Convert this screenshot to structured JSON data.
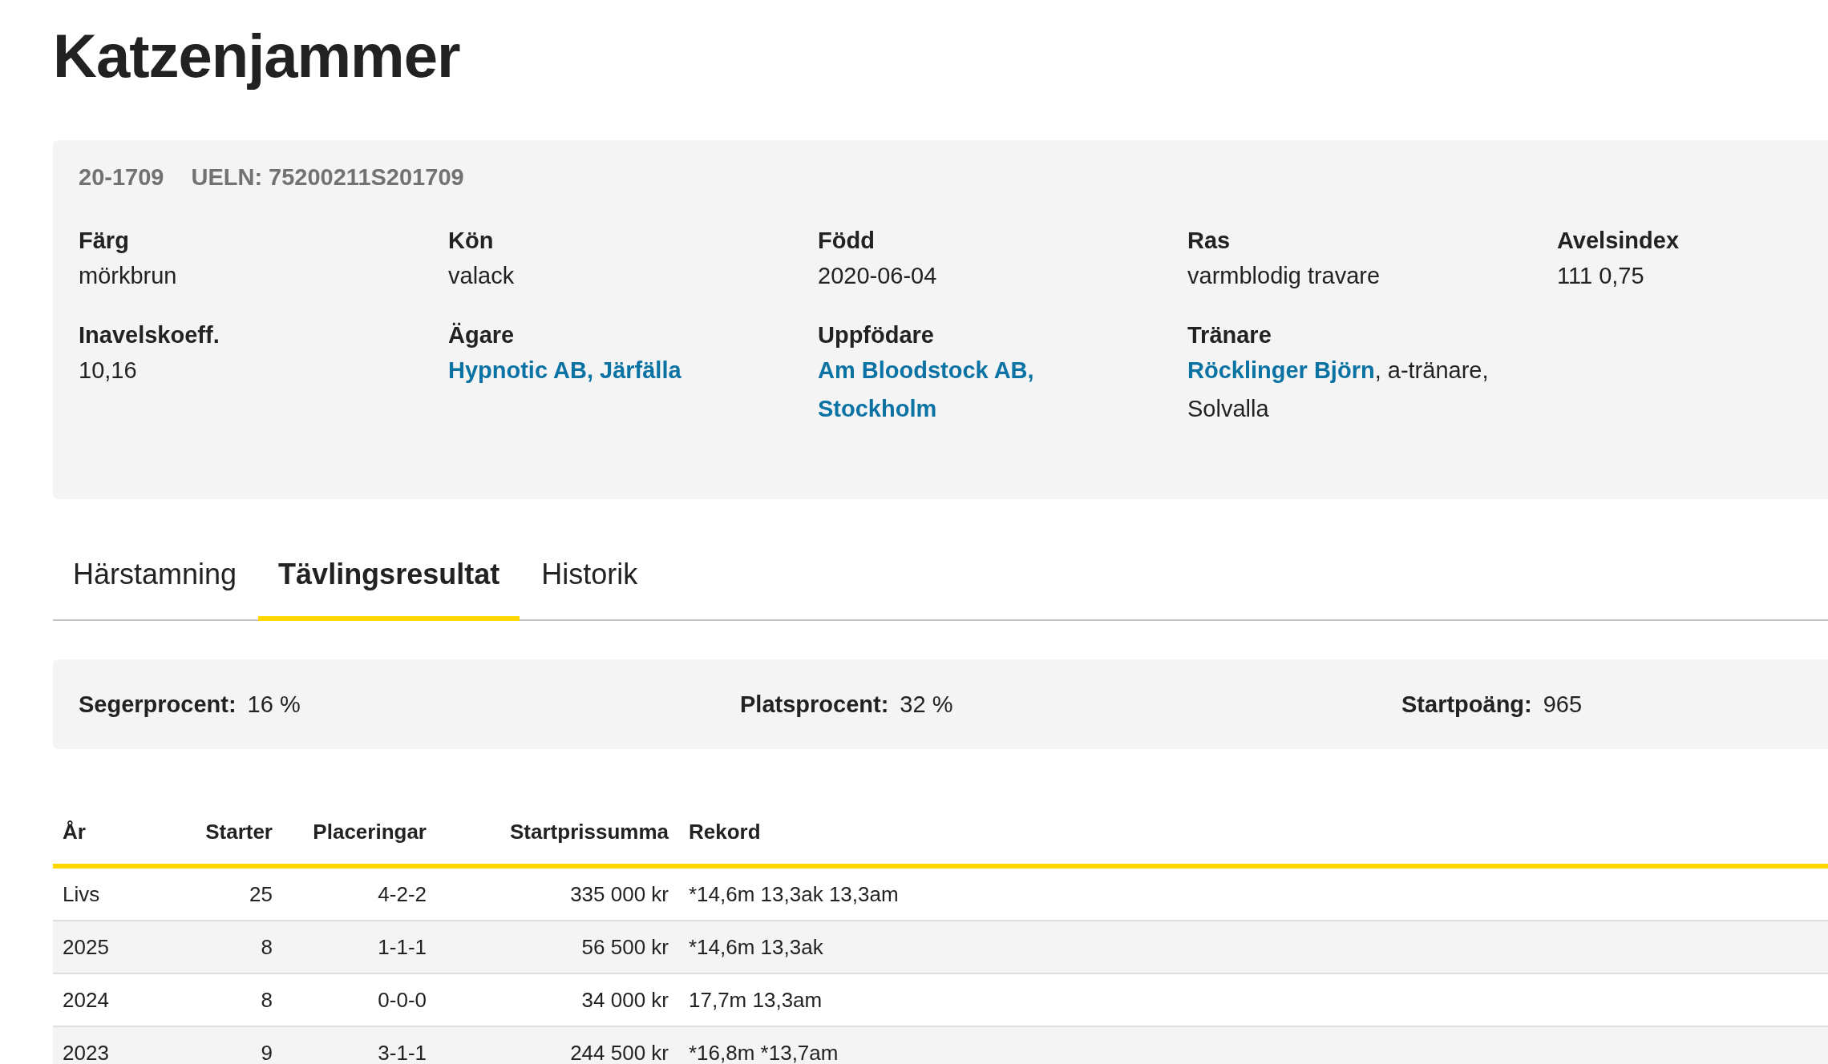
{
  "title": "Katzenjammer",
  "info": {
    "ids": [
      "20-1709",
      "UELN: 75200211S201709"
    ],
    "fields": [
      {
        "label": "Färg",
        "value": [
          {
            "text": "mörkbrun",
            "link": false
          }
        ]
      },
      {
        "label": "Kön",
        "value": [
          {
            "text": "valack",
            "link": false
          }
        ]
      },
      {
        "label": "Född",
        "value": [
          {
            "text": "2020-06-04",
            "link": false
          }
        ]
      },
      {
        "label": "Ras",
        "value": [
          {
            "text": "varmblodig travare",
            "link": false
          }
        ]
      },
      {
        "label": "Avelsindex",
        "value": [
          {
            "text": "111 0,75",
            "link": false
          }
        ]
      },
      {
        "label": "Inavelskoeff.",
        "value": [
          {
            "text": "10,16",
            "link": false
          }
        ]
      },
      {
        "label": "Ägare",
        "value": [
          {
            "text": "Hypnotic AB, Järfälla",
            "link": true
          }
        ]
      },
      {
        "label": "Uppfödare",
        "value": [
          {
            "text": "Am Bloodstock AB, Stockholm",
            "link": true
          }
        ]
      },
      {
        "label": "Tränare",
        "value": [
          {
            "text": "Röcklinger Björn",
            "link": true
          },
          {
            "text": ", a-tränare, Solvalla",
            "link": false
          }
        ]
      }
    ]
  },
  "tabs": [
    {
      "label": "Härstamning",
      "selected": false
    },
    {
      "label": "Tävlingsresultat",
      "selected": true
    },
    {
      "label": "Historik",
      "selected": false
    }
  ],
  "stats": [
    {
      "label": "Segerprocent:",
      "value": "16 %"
    },
    {
      "label": "Platsprocent:",
      "value": "32 %"
    },
    {
      "label": "Startpoäng:",
      "value": "965"
    }
  ],
  "table": {
    "columns": [
      "År",
      "Starter",
      "Placeringar",
      "Startprissumma",
      "Rekord"
    ],
    "rows": [
      [
        "Livs",
        "25",
        "4-2-2",
        "335 000 kr",
        "*14,6m 13,3ak 13,3am"
      ],
      [
        "2025",
        "8",
        "1-1-1",
        "56 500 kr",
        "*14,6m 13,3ak"
      ],
      [
        "2024",
        "8",
        "0-0-0",
        "34 000 kr",
        "17,7m 13,3am"
      ],
      [
        "2023",
        "9",
        "3-1-1",
        "244 500 kr",
        "*16,8m *13,7am"
      ]
    ]
  }
}
